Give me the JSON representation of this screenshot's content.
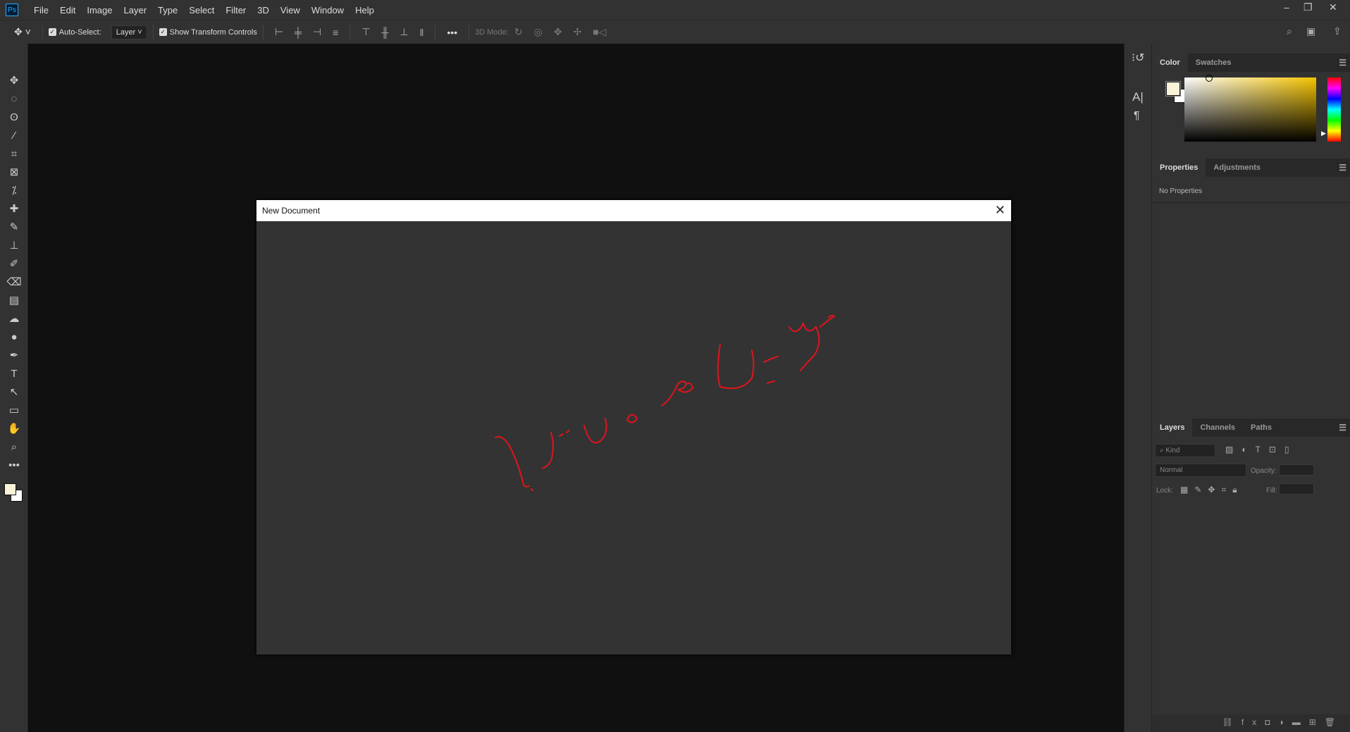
{
  "app": {
    "logo": "Ps"
  },
  "menu": [
    "File",
    "Edit",
    "Image",
    "Layer",
    "Type",
    "Select",
    "Filter",
    "3D",
    "View",
    "Window",
    "Help"
  ],
  "window_controls": {
    "minimize": "–",
    "restore": "❐",
    "close": "✕"
  },
  "options": {
    "auto_select_label": "Auto-Select:",
    "auto_select_checked": true,
    "auto_select_target": "Layer",
    "show_transform_label": "Show Transform Controls",
    "show_transform_checked": true,
    "more": "•••",
    "mode_3d_label": "3D Mode:"
  },
  "tools": [
    "move",
    "marquee",
    "lasso",
    "magic-wand",
    "crop",
    "frame",
    "eyedropper",
    "healing",
    "brush",
    "stamp",
    "history-brush",
    "eraser",
    "gradient",
    "smudge",
    "dodge",
    "pen",
    "type",
    "path-select",
    "rectangle",
    "hand",
    "zoom",
    "more"
  ],
  "tool_glyphs": [
    "✥",
    "◌",
    "ʘ",
    "⁄",
    "⌗",
    "⊠",
    "⁒",
    "✚",
    "✎",
    "⊥",
    "✐",
    "⌫",
    "▤",
    "☁",
    "●",
    "✒",
    "T",
    "↖",
    "▭",
    "✋",
    "⌕",
    "•••"
  ],
  "colors": {
    "foreground": "#fbf3d8",
    "background": "#ffffff",
    "accent_red": "#e0141c"
  },
  "dialog": {
    "title": "New Document",
    "close": "✕"
  },
  "panels": {
    "color": {
      "tabs": [
        "Color",
        "Swatches"
      ],
      "active": 0
    },
    "properties": {
      "tabs": [
        "Properties",
        "Adjustments"
      ],
      "active": 0,
      "empty_text": "No Properties"
    },
    "layers": {
      "tabs": [
        "Layers",
        "Channels",
        "Paths"
      ],
      "active": 0,
      "filter_placeholder": "Kind",
      "blend_mode": "Normal",
      "opacity_label": "Opacity:",
      "lock_label": "Lock:",
      "fill_label": "Fill:"
    }
  }
}
